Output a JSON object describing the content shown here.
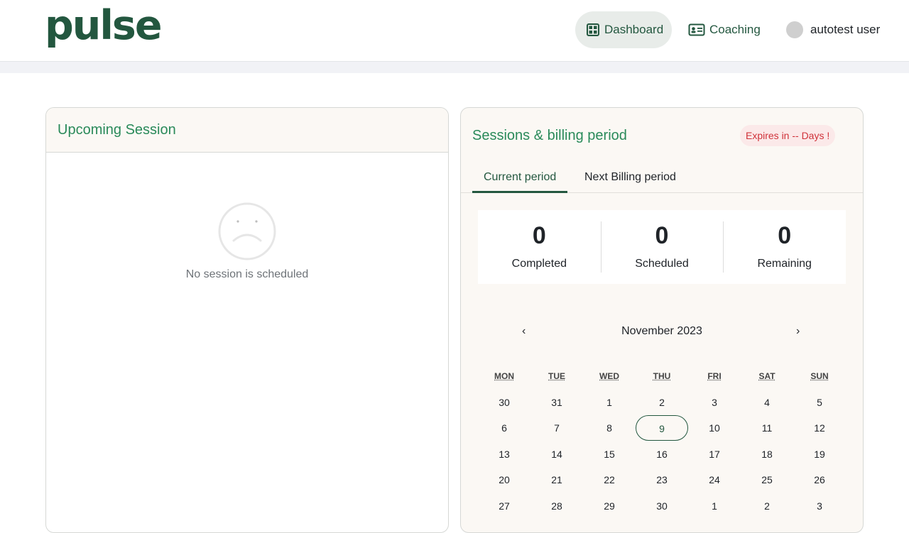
{
  "header": {
    "logo": "pulse",
    "nav": [
      {
        "label": "Dashboard",
        "icon": "grid-icon"
      },
      {
        "label": "Coaching",
        "icon": "id-card-icon"
      }
    ],
    "user": "autotest user"
  },
  "upcoming": {
    "title": "Upcoming Session",
    "empty_text": "No session is scheduled"
  },
  "billing": {
    "title": "Sessions & billing period",
    "badge": "Expires in -- Days !",
    "tabs": [
      "Current period",
      "Next Billing period"
    ],
    "stats": [
      {
        "value": "0",
        "label": "Completed"
      },
      {
        "value": "0",
        "label": "Scheduled"
      },
      {
        "value": "0",
        "label": "Remaining"
      }
    ]
  },
  "calendar": {
    "prev": "‹",
    "next": "›",
    "month": "November 2023",
    "weekdays": [
      "MON",
      "TUE",
      "WED",
      "THU",
      "FRI",
      "SAT",
      "SUN"
    ],
    "today": "9",
    "weeks": [
      [
        "30",
        "31",
        "1",
        "2",
        "3",
        "4",
        "5"
      ],
      [
        "6",
        "7",
        "8",
        "9",
        "10",
        "11",
        "12"
      ],
      [
        "13",
        "14",
        "15",
        "16",
        "17",
        "18",
        "19"
      ],
      [
        "20",
        "21",
        "22",
        "23",
        "24",
        "25",
        "26"
      ],
      [
        "27",
        "28",
        "29",
        "30",
        "1",
        "2",
        "3"
      ]
    ]
  },
  "colors": {
    "brand": "#23573f",
    "accent": "#2a8a5a",
    "danger": "#d0323a"
  }
}
